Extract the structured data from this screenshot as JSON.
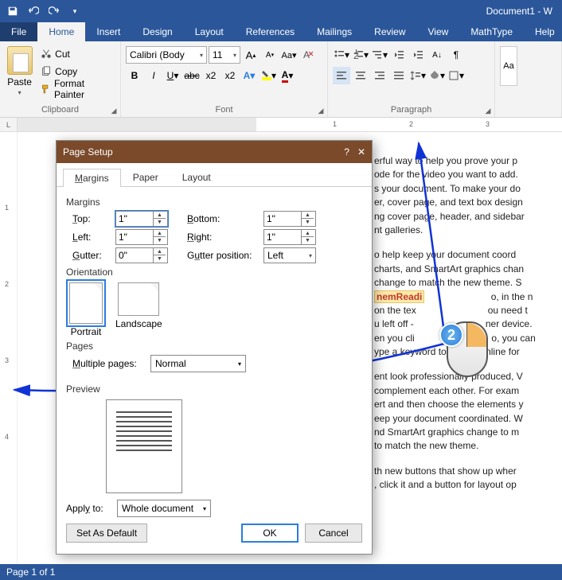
{
  "title_doc": "Document1 - W",
  "tabs": {
    "file": "File",
    "home": "Home",
    "insert": "Insert",
    "design": "Design",
    "layout": "Layout",
    "references": "References",
    "mailings": "Mailings",
    "review": "Review",
    "view": "View",
    "mathtype": "MathType",
    "help": "Help"
  },
  "ribbon": {
    "clipboard": {
      "label": "Clipboard",
      "paste": "Paste",
      "cut": "Cut",
      "copy": "Copy",
      "painter": "Format Painter"
    },
    "font": {
      "label": "Font",
      "name": "Calibri (Body",
      "size": "11"
    },
    "paragraph": {
      "label": "Paragraph"
    },
    "styles": {
      "chip": "Aa"
    }
  },
  "ruler": {
    "corner": "L",
    "t1": "1",
    "t2": "2",
    "t3": "3"
  },
  "vruler": {
    "v1": "1",
    "v2": "2",
    "v3": "3",
    "v4": "4"
  },
  "document": {
    "p1": "erful way to help you prove your p",
    "p1b": "ode for the video you want to add.",
    "p1c": "s your document. To make your do",
    "p1d": "er, cover page, and text box design",
    "p1e": "ng cover page, header, and sidebar",
    "p1f": "nt galleries.",
    "p2a": "o help keep your document coord",
    "p2b": "charts, and SmartArt graphics chan",
    "p2c": "change to match the new theme. S",
    "highlight": "nemReadi",
    "p2d": "o, in the n",
    "p2e": "on the tex",
    "p2f": "ou need t",
    "p2g": "u left off -",
    "p2h": "ner device.",
    "p2i": "en you cli",
    "p2j": "o, you can",
    "p2k": "ype a keyword to search online for",
    "p3a": "ent look professionally produced, V",
    "p3b": "complement each other. For exam",
    "p3c": "ert and then choose the elements y",
    "p3d": "eep your document coordinated. W",
    "p3e": "nd SmartArt graphics change to m",
    "p3f": " to match the new theme.",
    "p4a": "th new buttons that show up wher",
    "p4b": ", click it and a button for layout op"
  },
  "status": {
    "page": "Page 1 of 1"
  },
  "dialog": {
    "title": "Page Setup",
    "tabs": {
      "margins": "Margins",
      "paper": "Paper",
      "layout": "Layout"
    },
    "sec_margins": "Margins",
    "top": "Top:",
    "top_v": "1\"",
    "bottom": "Bottom:",
    "bottom_v": "1\"",
    "left": "Left:",
    "left_v": "1\"",
    "right": "Right:",
    "right_v": "1\"",
    "gutter": "Gutter:",
    "gutter_v": "0\"",
    "gutter_pos": "Gutter position:",
    "gutter_pos_v": "Left",
    "sec_orient": "Orientation",
    "portrait": "Portrait",
    "landscape": "Landscape",
    "sec_pages": "Pages",
    "multiple": "Multiple pages:",
    "multiple_v": "Normal",
    "sec_preview": "Preview",
    "apply": "Apply to:",
    "apply_v": "Whole document",
    "set_default": "Set As Default",
    "ok": "OK",
    "cancel": "Cancel",
    "help": "?",
    "close": "✕"
  },
  "cue": {
    "num": "2"
  }
}
